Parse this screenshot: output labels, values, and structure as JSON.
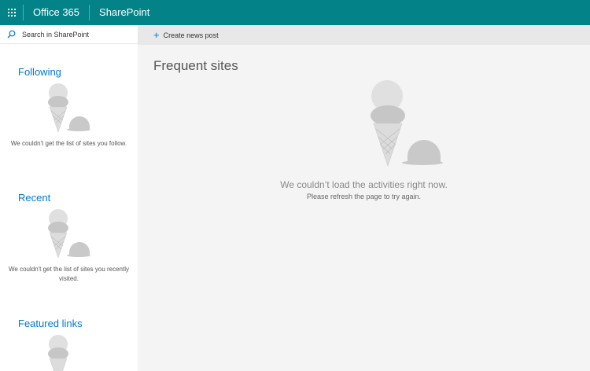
{
  "suite": {
    "app_launcher_icon": "waffle-icon",
    "brand": "Office 365",
    "site": "SharePoint"
  },
  "search": {
    "icon": "search-icon",
    "placeholder": "Search in SharePoint"
  },
  "commandbar": {
    "create_icon": "plus-icon",
    "create_label": "Create news post"
  },
  "leftrail": {
    "sections": [
      {
        "heading": "Following",
        "message": "We couldn't get the list of sites you follow."
      },
      {
        "heading": "Recent",
        "message": "We couldn't get the list of sites you recently visited."
      },
      {
        "heading": "Featured links",
        "message": ""
      }
    ]
  },
  "main": {
    "title": "Frequent sites",
    "error_title": "We couldn’t load the activities right now.",
    "error_detail": "Please refresh the page to try again."
  },
  "colors": {
    "suite_bar": "#038387",
    "accent_blue": "#0078d4",
    "background": "#f4f4f4"
  }
}
